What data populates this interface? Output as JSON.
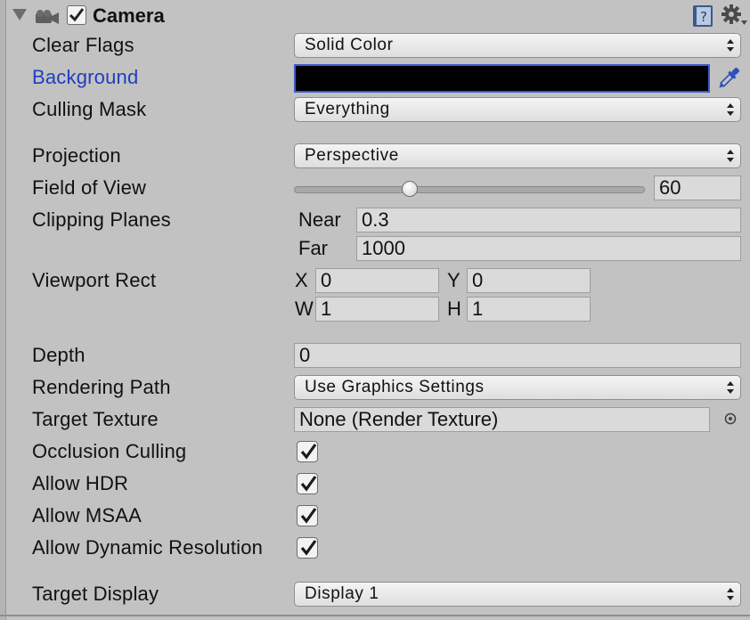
{
  "component": {
    "title": "Camera",
    "enabled": true,
    "icons": {
      "fold": "foldout-arrow-icon",
      "type": "camera-icon",
      "help": "help-book-icon",
      "settings": "gear-icon"
    }
  },
  "fields": {
    "clear_flags": {
      "label": "Clear Flags",
      "value": "Solid Color"
    },
    "background": {
      "label": "Background",
      "color": "#000000"
    },
    "culling_mask": {
      "label": "Culling Mask",
      "value": "Everything"
    },
    "projection": {
      "label": "Projection",
      "value": "Perspective"
    },
    "field_of_view": {
      "label": "Field of View",
      "value": "60",
      "slider_fraction": 0.33
    },
    "clipping_planes": {
      "label": "Clipping Planes",
      "near_label": "Near",
      "near_value": "0.3",
      "far_label": "Far",
      "far_value": "1000"
    },
    "viewport_rect": {
      "label": "Viewport Rect",
      "x_label": "X",
      "x_value": "0",
      "y_label": "Y",
      "y_value": "0",
      "w_label": "W",
      "w_value": "1",
      "h_label": "H",
      "h_value": "1"
    },
    "depth": {
      "label": "Depth",
      "value": "0"
    },
    "rendering_path": {
      "label": "Rendering Path",
      "value": "Use Graphics Settings"
    },
    "target_texture": {
      "label": "Target Texture",
      "value": "None (Render Texture)"
    },
    "occlusion_culling": {
      "label": "Occlusion Culling",
      "checked": true
    },
    "allow_hdr": {
      "label": "Allow HDR",
      "checked": true
    },
    "allow_msaa": {
      "label": "Allow MSAA",
      "checked": true
    },
    "allow_dynamic_resolution": {
      "label": "Allow Dynamic Resolution",
      "checked": true
    },
    "target_display": {
      "label": "Target Display",
      "value": "Display 1"
    }
  },
  "colors": {
    "panel_bg": "#c2c2c2",
    "prefab_override_label": "#1f3fbf",
    "color_field_border": "#3d5bd0"
  }
}
